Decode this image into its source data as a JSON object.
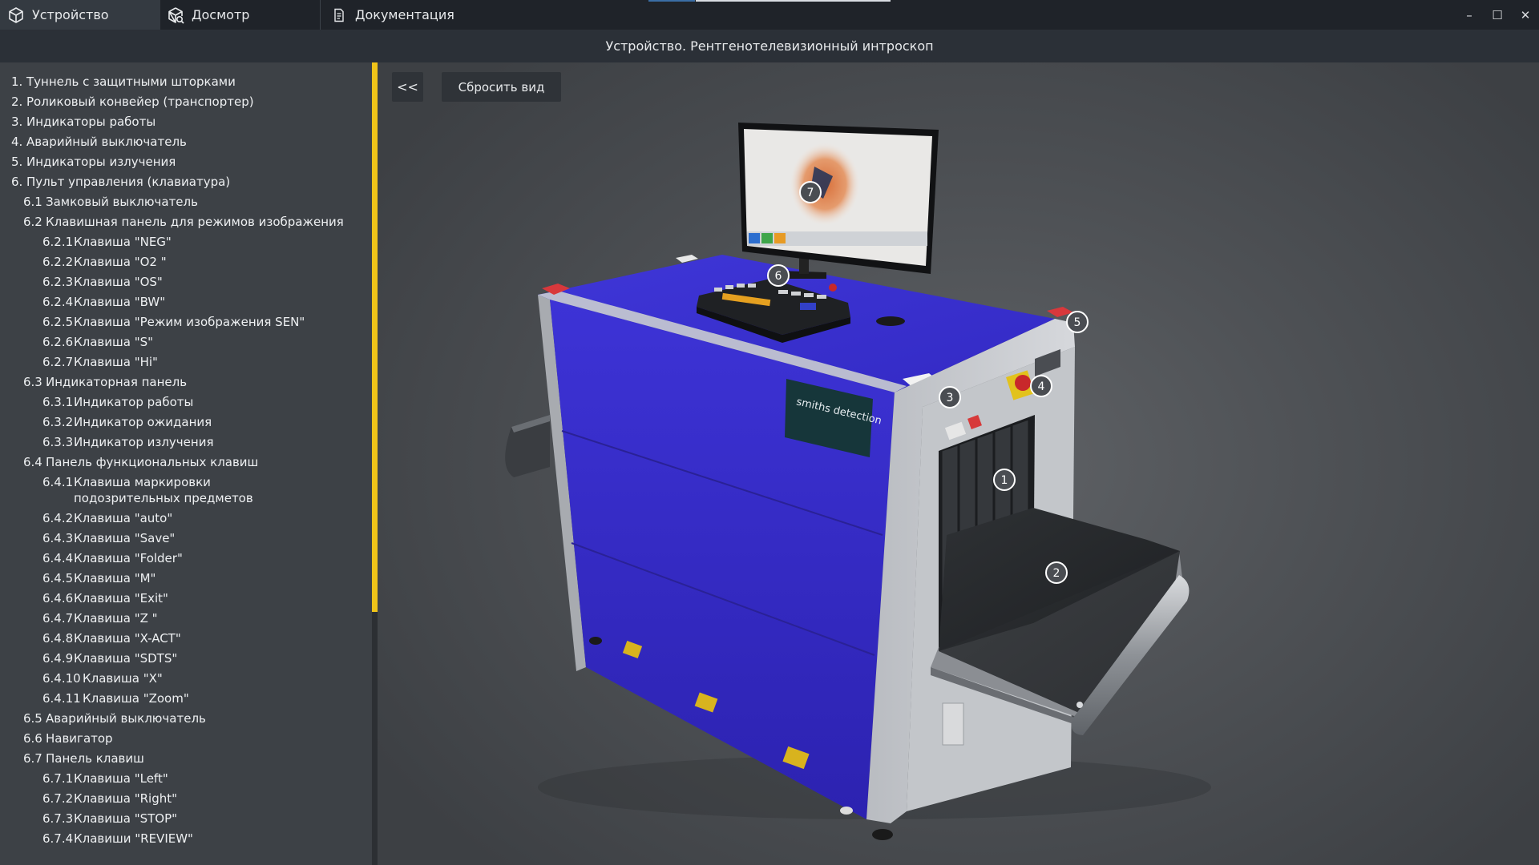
{
  "window": {
    "tabs": [
      {
        "label": "Устройство",
        "icon": "cube-icon",
        "active": true
      },
      {
        "label": "Досмотр",
        "icon": "cube-search-icon",
        "active": false
      },
      {
        "label": "Документация",
        "icon": "document-icon",
        "active": false
      }
    ],
    "controls": {
      "minimize": "–",
      "maximize": "☐",
      "close": "✕"
    }
  },
  "header": {
    "title": "Устройство. Рентгенотелевизионный интроскоп"
  },
  "sidebar": {
    "items": [
      {
        "num": "1.",
        "label": "Туннель с защитными шторками"
      },
      {
        "num": "2.",
        "label": "Роликовый конвейер (транспортер)"
      },
      {
        "num": "3.",
        "label": "Индикаторы работы"
      },
      {
        "num": "4.",
        "label": "Аварийный выключатель"
      },
      {
        "num": "5.",
        "label": "Индикаторы излучения"
      },
      {
        "num": "6.",
        "label": "Пульт управления (клавиатура)"
      },
      {
        "num": "6.1",
        "label": "Замковый выключатель"
      },
      {
        "num": "6.2",
        "label": "Клавишная панель для режимов изображения"
      },
      {
        "num": "6.2.1",
        "label": "Клавиша \"NEG\""
      },
      {
        "num": "6.2.2",
        "label": "Клавиша \"O2 \""
      },
      {
        "num": "6.2.3",
        "label": "Клавиша \"OS\""
      },
      {
        "num": "6.2.4",
        "label": "Клавиша \"BW\""
      },
      {
        "num": "6.2.5",
        "label": "Клавиша \"Режим изображения SEN\""
      },
      {
        "num": "6.2.6",
        "label": "Клавиша \"S\""
      },
      {
        "num": "6.2.7",
        "label": "Клавиша \"Hi\""
      },
      {
        "num": "6.3",
        "label": "Индикаторная панель"
      },
      {
        "num": "6.3.1",
        "label": "Индикатор работы"
      },
      {
        "num": "6.3.2",
        "label": "Индикатор ожидания"
      },
      {
        "num": "6.3.3",
        "label": "Индикатор излучения"
      },
      {
        "num": "6.4",
        "label": "Панель функциональных клавиш"
      },
      {
        "num": "6.4.1",
        "label": "Клавиша маркировки подозрительных предметов"
      },
      {
        "num": "6.4.2",
        "label": "Клавиша \"auto\""
      },
      {
        "num": "6.4.3",
        "label": "Клавиша \"Save\""
      },
      {
        "num": "6.4.4",
        "label": "Клавиша \"Folder\""
      },
      {
        "num": "6.4.5",
        "label": "Клавиша \"M\""
      },
      {
        "num": "6.4.6",
        "label": "Клавиша \"Exit\""
      },
      {
        "num": "6.4.7",
        "label": "Клавиша \"Z \""
      },
      {
        "num": "6.4.8",
        "label": "Клавиша \"X-ACT\""
      },
      {
        "num": "6.4.9",
        "label": "Клавиша \"SDTS\""
      },
      {
        "num": "6.4.10",
        "label": "Клавиша \"X\""
      },
      {
        "num": "6.4.11",
        "label": "Клавиша \"Zoom\""
      },
      {
        "num": "6.5",
        "label": "Аварийный выключатель"
      },
      {
        "num": "6.6",
        "label": "Навигатор"
      },
      {
        "num": "6.7",
        "label": "Панель клавиш"
      },
      {
        "num": "6.7.1",
        "label": "Клавиша \"Left\""
      },
      {
        "num": "6.7.2",
        "label": "Клавиша \"Right\""
      },
      {
        "num": "6.7.3",
        "label": "Клавиша \"STOP\""
      },
      {
        "num": "6.7.4",
        "label": "Клавиши \"REVIEW\""
      }
    ]
  },
  "viewport": {
    "collapse_label": "<<",
    "reset_label": "Сбросить вид",
    "brand_line1": "smiths detection",
    "markers": [
      "1",
      "2",
      "3",
      "4",
      "5",
      "6",
      "7"
    ]
  },
  "colors": {
    "accent": "#f0c419",
    "machine_body": "#3a2fc8",
    "frame": "#c9cbcf",
    "sidebar_bg": "#3d4146",
    "titlebar_bg": "#1f2329"
  }
}
